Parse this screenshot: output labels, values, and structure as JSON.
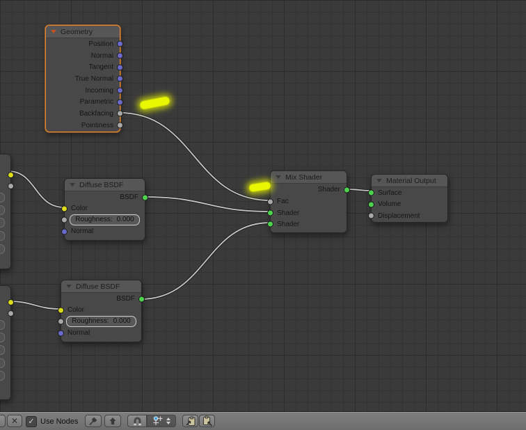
{
  "editor": {
    "app": "Blender",
    "view": "Node Editor (shader nodes)"
  },
  "colors": {
    "canvas_bg": "#3a3a3a",
    "grid_line": "#333333",
    "grid_major": "#2c2c2c",
    "node_body": "#484848",
    "node_header": "#565656",
    "selected_outline": "#e5862d",
    "wire": "#c6c6c6",
    "highlight_mark": "#e9f702",
    "sockets": {
      "vector": "#6a6acb",
      "value": "#a8a8a8",
      "color": "#dcdc1d",
      "shader": "#4ed34e"
    }
  },
  "nodes": {
    "geometry": {
      "title": "Geometry",
      "selected": true,
      "outputs": [
        {
          "label": "Position",
          "type": "vector"
        },
        {
          "label": "Normal",
          "type": "vector"
        },
        {
          "label": "Tangent",
          "type": "vector"
        },
        {
          "label": "True Normal",
          "type": "vector"
        },
        {
          "label": "Incoming",
          "type": "vector"
        },
        {
          "label": "Parametric",
          "type": "vector"
        },
        {
          "label": "Backfacing",
          "type": "value"
        },
        {
          "label": "Pointiness",
          "type": "value"
        }
      ]
    },
    "diffuse1": {
      "title": "Diffuse BSDF",
      "output": {
        "label": "BSDF",
        "type": "shader"
      },
      "color_input": {
        "label": "Color",
        "type": "color"
      },
      "roughness": {
        "label": "Roughness:",
        "value": "0.000",
        "type": "value"
      },
      "normal_input": {
        "label": "Normal",
        "type": "vector"
      }
    },
    "diffuse2": {
      "title": "Diffuse BSDF",
      "output": {
        "label": "BSDF",
        "type": "shader"
      },
      "color_input": {
        "label": "Color",
        "type": "color"
      },
      "roughness": {
        "label": "Roughness:",
        "value": "0.000",
        "type": "value"
      },
      "normal_input": {
        "label": "Normal",
        "type": "vector"
      }
    },
    "mix": {
      "title": "Mix Shader",
      "output": {
        "label": "Shader",
        "type": "shader"
      },
      "inputs": [
        {
          "label": "Fac",
          "type": "value"
        },
        {
          "label": "Shader",
          "type": "shader"
        },
        {
          "label": "Shader",
          "type": "shader"
        }
      ]
    },
    "material_output": {
      "title": "Material Output",
      "inputs": [
        {
          "label": "Surface",
          "type": "shader"
        },
        {
          "label": "Volume",
          "type": "shader"
        },
        {
          "label": "Displacement",
          "type": "value"
        }
      ]
    }
  },
  "partials": [
    {
      "sockets": [
        "color",
        "value"
      ]
    },
    {
      "sockets": [
        "color",
        "value"
      ]
    }
  ],
  "connections": [
    "Geometry.Backfacing -> Mix Shader.Fac",
    "Diffuse BSDF(1).BSDF -> Mix Shader.Shader(1)",
    "Diffuse BSDF(2).BSDF -> Mix Shader.Shader(2)",
    "Mix Shader.Shader -> Material Output.Surface",
    "offscreen node(1) -> Diffuse BSDF(1).Color",
    "offscreen node(2) -> Diffuse BSDF(2).Color"
  ],
  "annotations": {
    "highlight_marks": 2
  },
  "toolbar": {
    "use_nodes_label": "Use Nodes",
    "use_nodes_checked": true,
    "icons": {
      "check": "✓",
      "close": "✕"
    }
  }
}
